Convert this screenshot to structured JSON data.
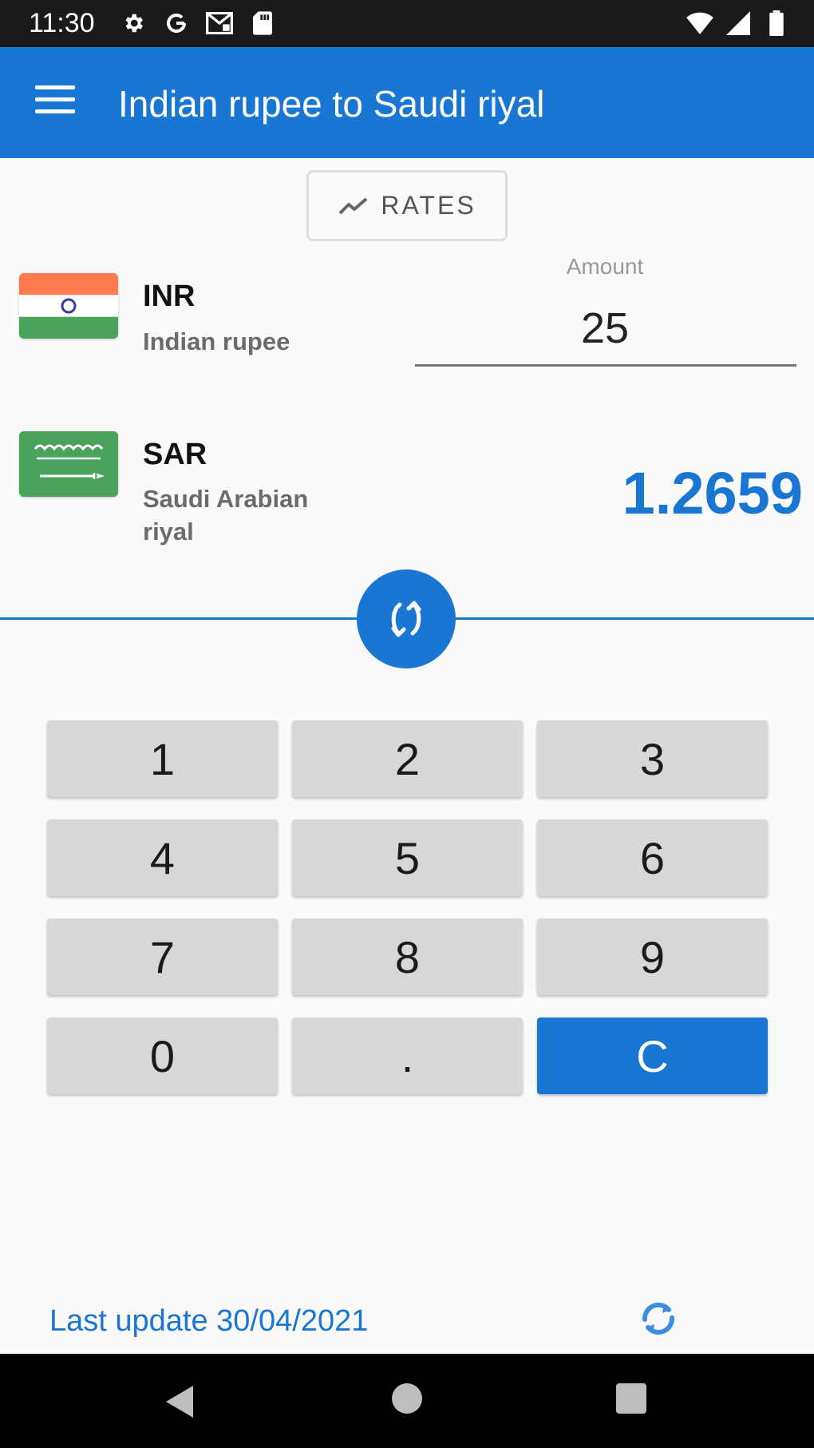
{
  "status_bar": {
    "time": "11:30",
    "left_icons": [
      "settings-icon",
      "google-icon",
      "gmail-icon",
      "sd-card-icon"
    ],
    "right_icons": [
      "wifi-icon",
      "signal-icon",
      "battery-icon"
    ]
  },
  "app_bar": {
    "title": "Indian rupee to Saudi riyal",
    "menu_icon": "menu-icon",
    "color": "#1976d2"
  },
  "rates_button": {
    "label": "RATES",
    "icon": "trending-icon"
  },
  "from_currency": {
    "code": "INR",
    "name": "Indian rupee",
    "flag": "india-flag",
    "amount_label": "Amount",
    "amount": "25"
  },
  "to_currency": {
    "code": "SAR",
    "name": "Saudi Arabian riyal",
    "flag": "saudi-flag",
    "result": "1.2659"
  },
  "swap_button": {
    "icon": "swap-icon"
  },
  "keypad": {
    "keys": [
      "1",
      "2",
      "3",
      "4",
      "5",
      "6",
      "7",
      "8",
      "9",
      "0",
      ".",
      "C"
    ]
  },
  "footer": {
    "last_update": "Last update 30/04/2021",
    "refresh_icon": "refresh-icon"
  },
  "nav_bar": {
    "icons": [
      "back-icon",
      "home-icon",
      "recents-icon"
    ]
  },
  "colors": {
    "primary": "#1976d2",
    "key_bg": "#d6d7d7",
    "background": "#fafafa"
  }
}
